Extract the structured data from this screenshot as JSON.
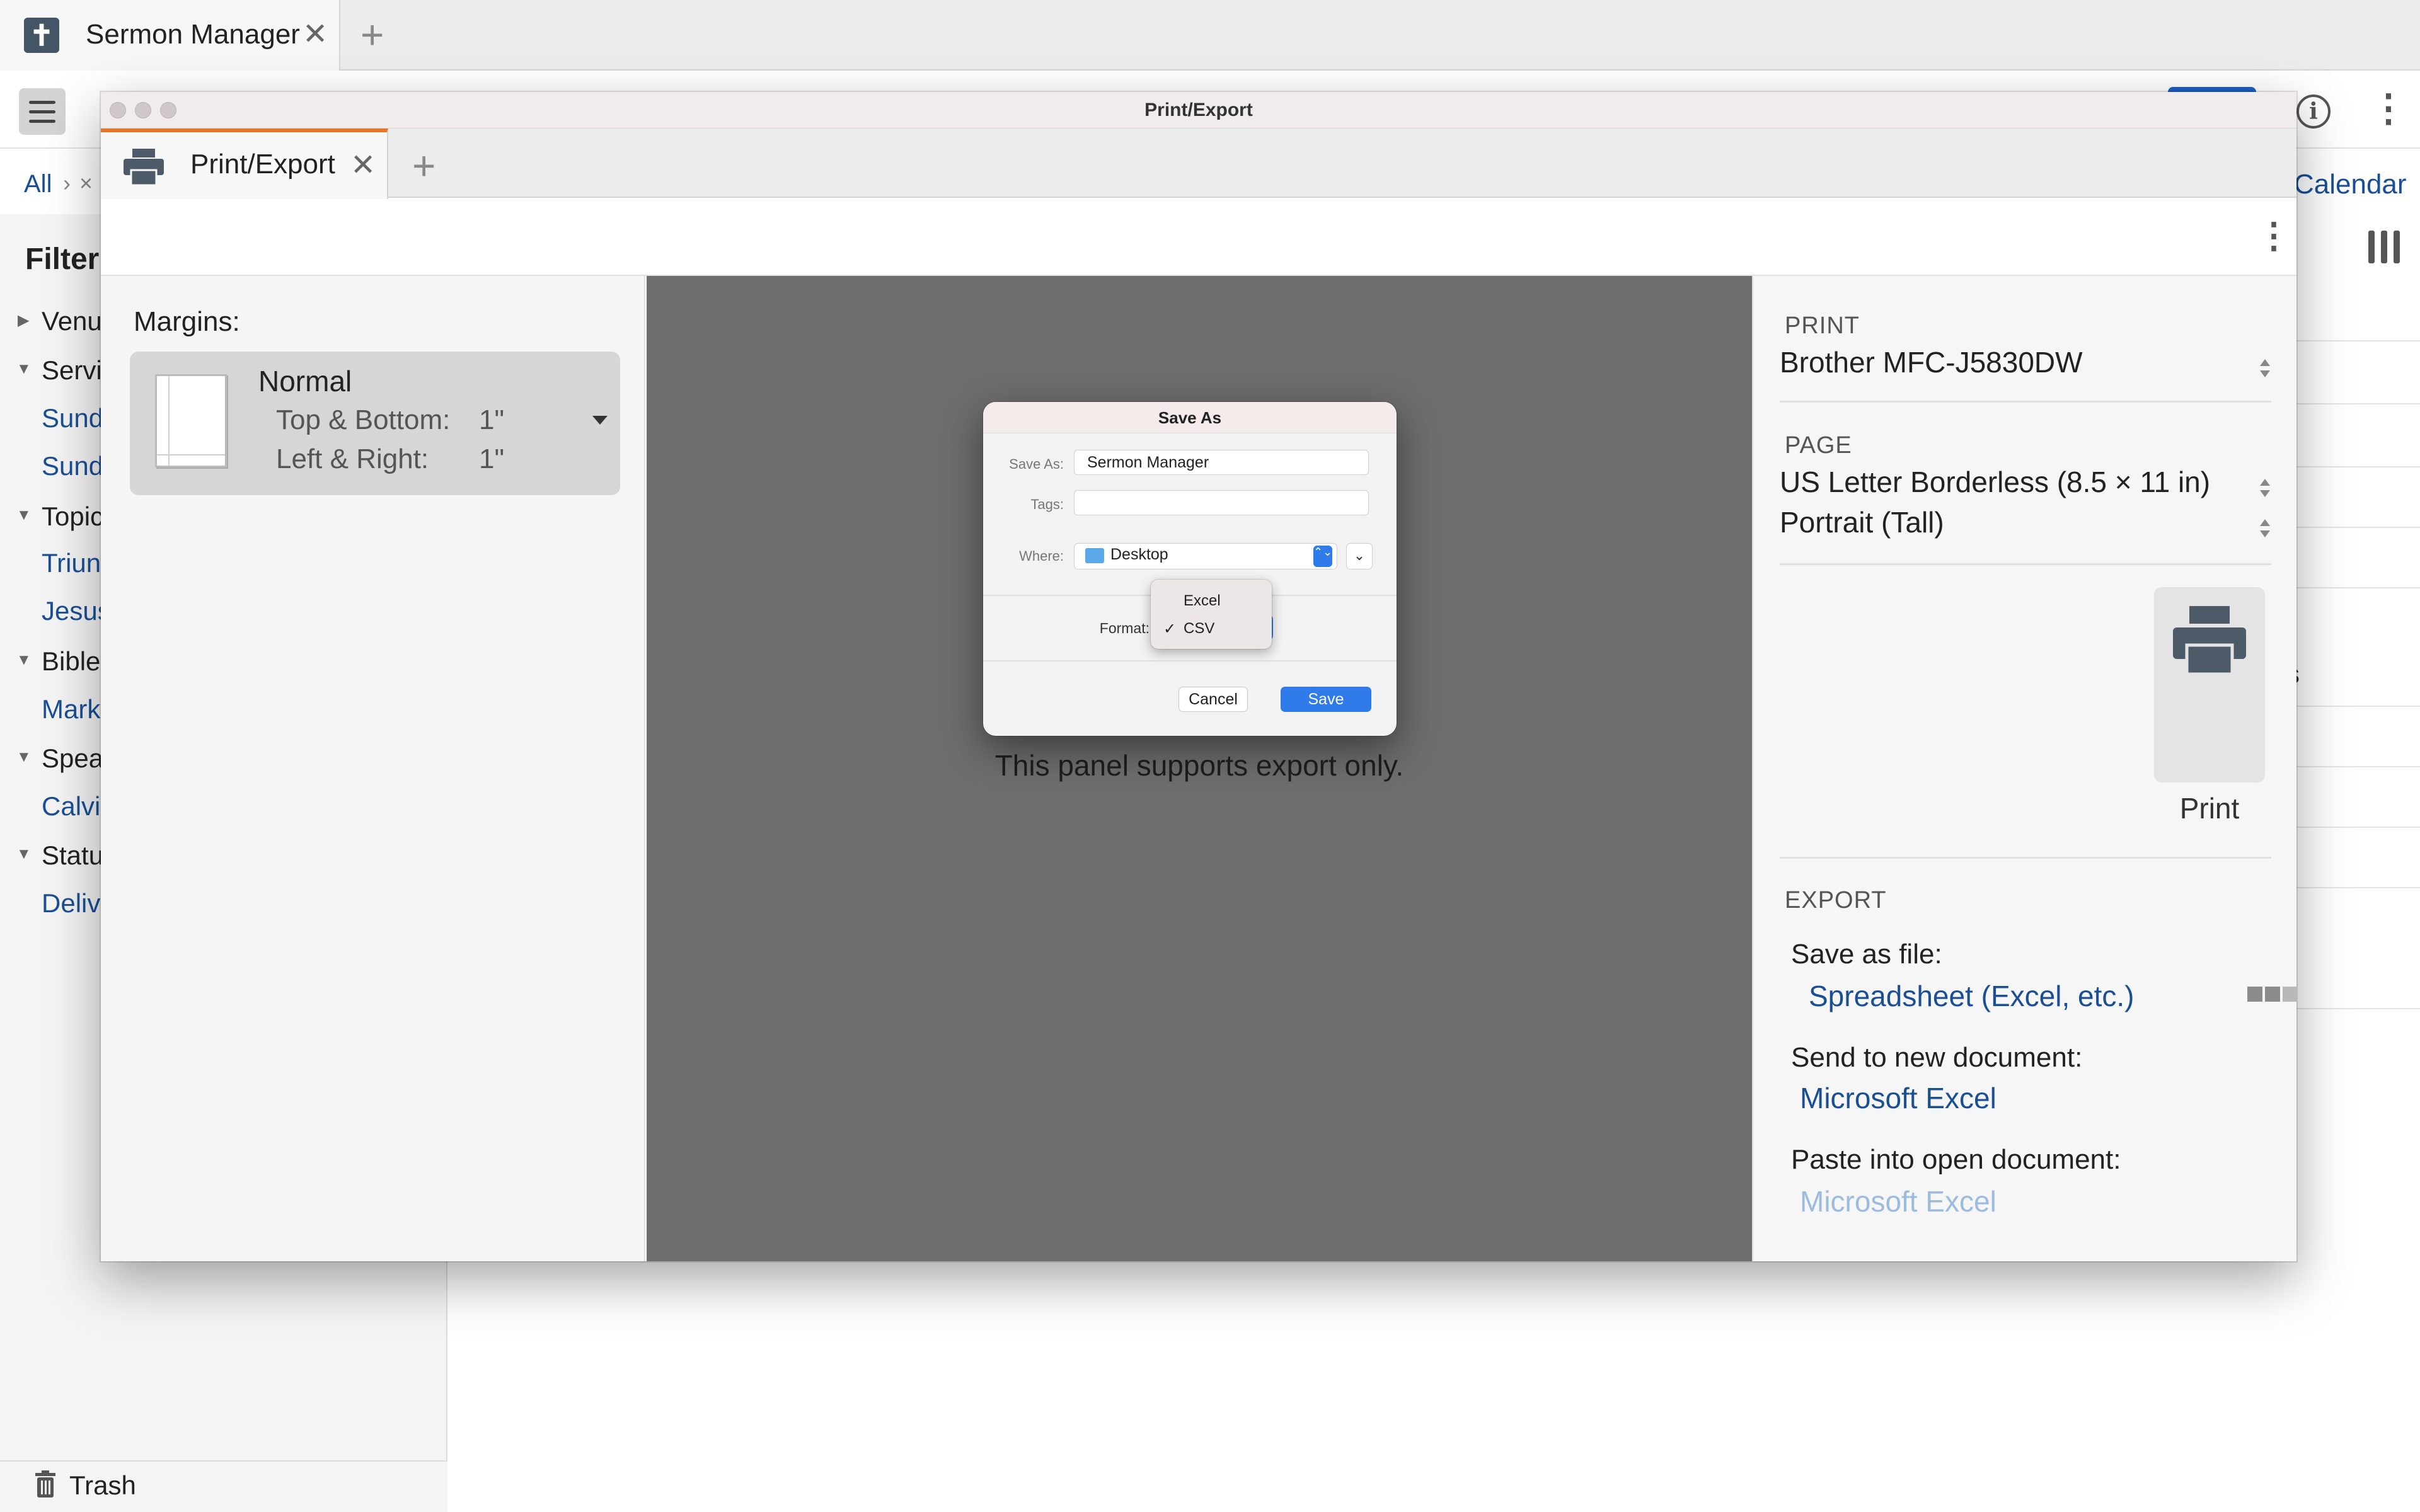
{
  "app": {
    "tab_title": "Sermon Manager",
    "tab_close": "✕",
    "tab_add": "+",
    "breadcrumb_all": "All",
    "breadcrumb_sep": "›",
    "breadcrumb_clear": "×",
    "calendar_link": "Calendar",
    "info_glyph": "i",
    "more_glyph": "⋮",
    "sidebar": {
      "title": "Filter",
      "sections": [
        {
          "label": "Venu",
          "links": []
        },
        {
          "label": "Servi",
          "links": [
            "Sund",
            "Sund"
          ]
        },
        {
          "label": "Topic",
          "links": [
            "Triun",
            "Jesus"
          ]
        },
        {
          "label": "Bible",
          "links": [
            "Mark"
          ]
        },
        {
          "label": "Spea",
          "links": [
            "Calvi"
          ]
        },
        {
          "label": "Statu",
          "links": [
            "Deliv"
          ]
        }
      ],
      "trash": "Trash"
    },
    "clipped_text": "s"
  },
  "print_export": {
    "window_title": "Print/Export",
    "tab_title": "Print/Export",
    "tab_close": "✕",
    "tab_add": "+",
    "more_glyph": "⋮",
    "margins": {
      "label": "Margins:",
      "preset": "Normal",
      "top_bottom_label": "Top & Bottom:",
      "top_bottom_value": "1\"",
      "left_right_label": "Left & Right:",
      "left_right_value": "1\""
    },
    "preview_message": "This panel supports export only.",
    "print": {
      "heading": "PRINT",
      "printer": "Brother MFC-J5830DW",
      "page_heading": "PAGE",
      "paper": "US Letter Borderless (8.5 × 11 in)",
      "orientation": "Portrait (Tall)",
      "print_button": "Print"
    },
    "export": {
      "heading": "EXPORT",
      "save_as_file_label": "Save as file:",
      "save_as_file_link": "Spreadsheet (Excel, etc.)",
      "progress_fraction": 0.4,
      "send_label": "Send to new document:",
      "send_link": "Microsoft Excel",
      "paste_label": "Paste into open document:",
      "paste_link": "Microsoft Excel"
    }
  },
  "save_as": {
    "title": "Save As",
    "save_as_label": "Save As:",
    "save_as_value": "Sermon Manager",
    "tags_label": "Tags:",
    "tags_value": "",
    "where_label": "Where:",
    "where_value": "Desktop",
    "where_arrows": "⌃⌄",
    "expand_glyph": "⌄",
    "format_label": "Format:",
    "format_options": [
      "Excel",
      "CSV"
    ],
    "format_selected": "CSV",
    "check_glyph": "✓",
    "cancel": "Cancel",
    "save": "Save"
  },
  "colors": {
    "accent_blue": "#2f7bea",
    "link_blue": "#1a4f96",
    "tab_accent_orange": "#e8762a",
    "preview_gray": "#6d6d6d"
  }
}
